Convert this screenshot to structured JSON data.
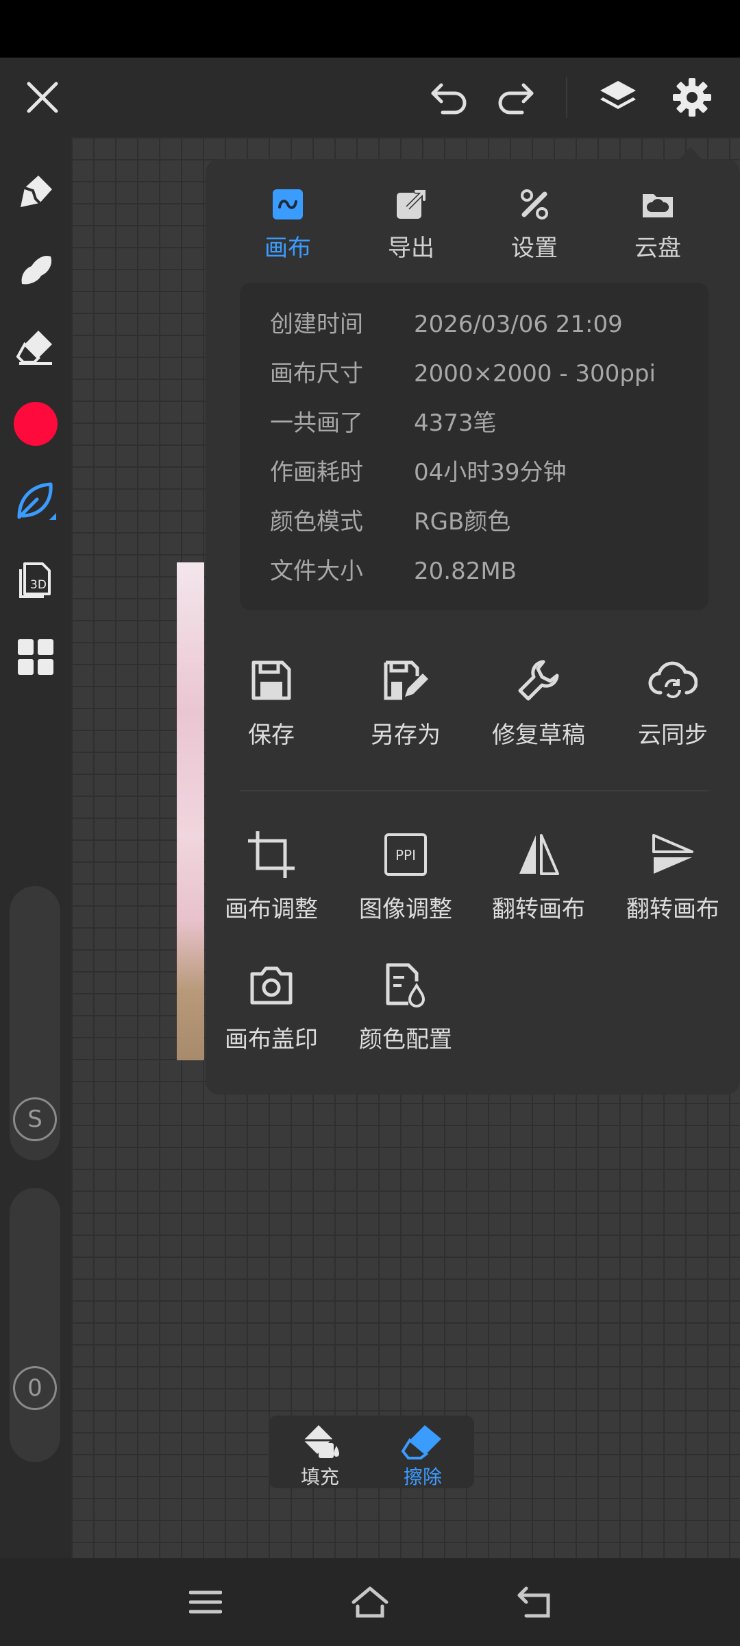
{
  "colors": {
    "accent": "#3b9cff",
    "brush_color": "#ff0a3c",
    "panel_bg": "#323233"
  },
  "toolbar": {
    "close_icon": "close-icon",
    "undo_icon": "undo-icon",
    "redo_icon": "redo-icon",
    "layers_icon": "layers-icon",
    "settings_icon": "gear-icon"
  },
  "left_tools": [
    "pen-tool-icon",
    "smudge-tool-icon",
    "eraser-tool-icon",
    "color-swatch",
    "leaf-brush-icon",
    "3d-tool-icon",
    "grid-apps-icon"
  ],
  "left_tool_3d_label": "3D",
  "sliders": {
    "size_label": "S",
    "opacity_label": "0"
  },
  "panel": {
    "tabs": [
      {
        "label": "画布",
        "icon": "canvas-icon",
        "active": true
      },
      {
        "label": "导出",
        "icon": "export-icon",
        "active": false
      },
      {
        "label": "设置",
        "icon": "settings-tools-icon",
        "active": false
      },
      {
        "label": "云盘",
        "icon": "cloud-drive-icon",
        "active": false
      }
    ],
    "info": [
      {
        "key": "创建时间",
        "value": "2026/03/06 21:09"
      },
      {
        "key": "画布尺寸",
        "value": "2000×2000 - 300ppi"
      },
      {
        "key": "一共画了",
        "value": "4373笔"
      },
      {
        "key": "作画耗时",
        "value": "04小时39分钟"
      },
      {
        "key": "颜色模式",
        "value": "RGB颜色"
      },
      {
        "key": "文件大小",
        "value": "20.82MB"
      }
    ],
    "actions_row1": [
      {
        "label": "保存",
        "icon": "save-icon"
      },
      {
        "label": "另存为",
        "icon": "save-as-icon"
      },
      {
        "label": "修复草稿",
        "icon": "wrench-icon"
      },
      {
        "label": "云同步",
        "icon": "cloud-sync-icon"
      }
    ],
    "actions_row2": [
      {
        "label": "画布调整",
        "icon": "crop-icon"
      },
      {
        "label": "图像调整",
        "icon": "ppi-icon",
        "icon_text": "PPI"
      },
      {
        "label": "翻转画布",
        "icon": "flip-horizontal-icon"
      },
      {
        "label": "翻转画布",
        "icon": "flip-vertical-icon"
      }
    ],
    "actions_row3": [
      {
        "label": "画布盖印",
        "icon": "camera-icon"
      },
      {
        "label": "颜色配置",
        "icon": "color-profile-icon"
      }
    ]
  },
  "bottom_tools": [
    {
      "label": "填充",
      "icon": "fill-bucket-icon",
      "active": false
    },
    {
      "label": "擦除",
      "icon": "eraser-icon",
      "active": true
    }
  ],
  "navbar": [
    "menu-icon",
    "home-icon",
    "back-icon"
  ]
}
